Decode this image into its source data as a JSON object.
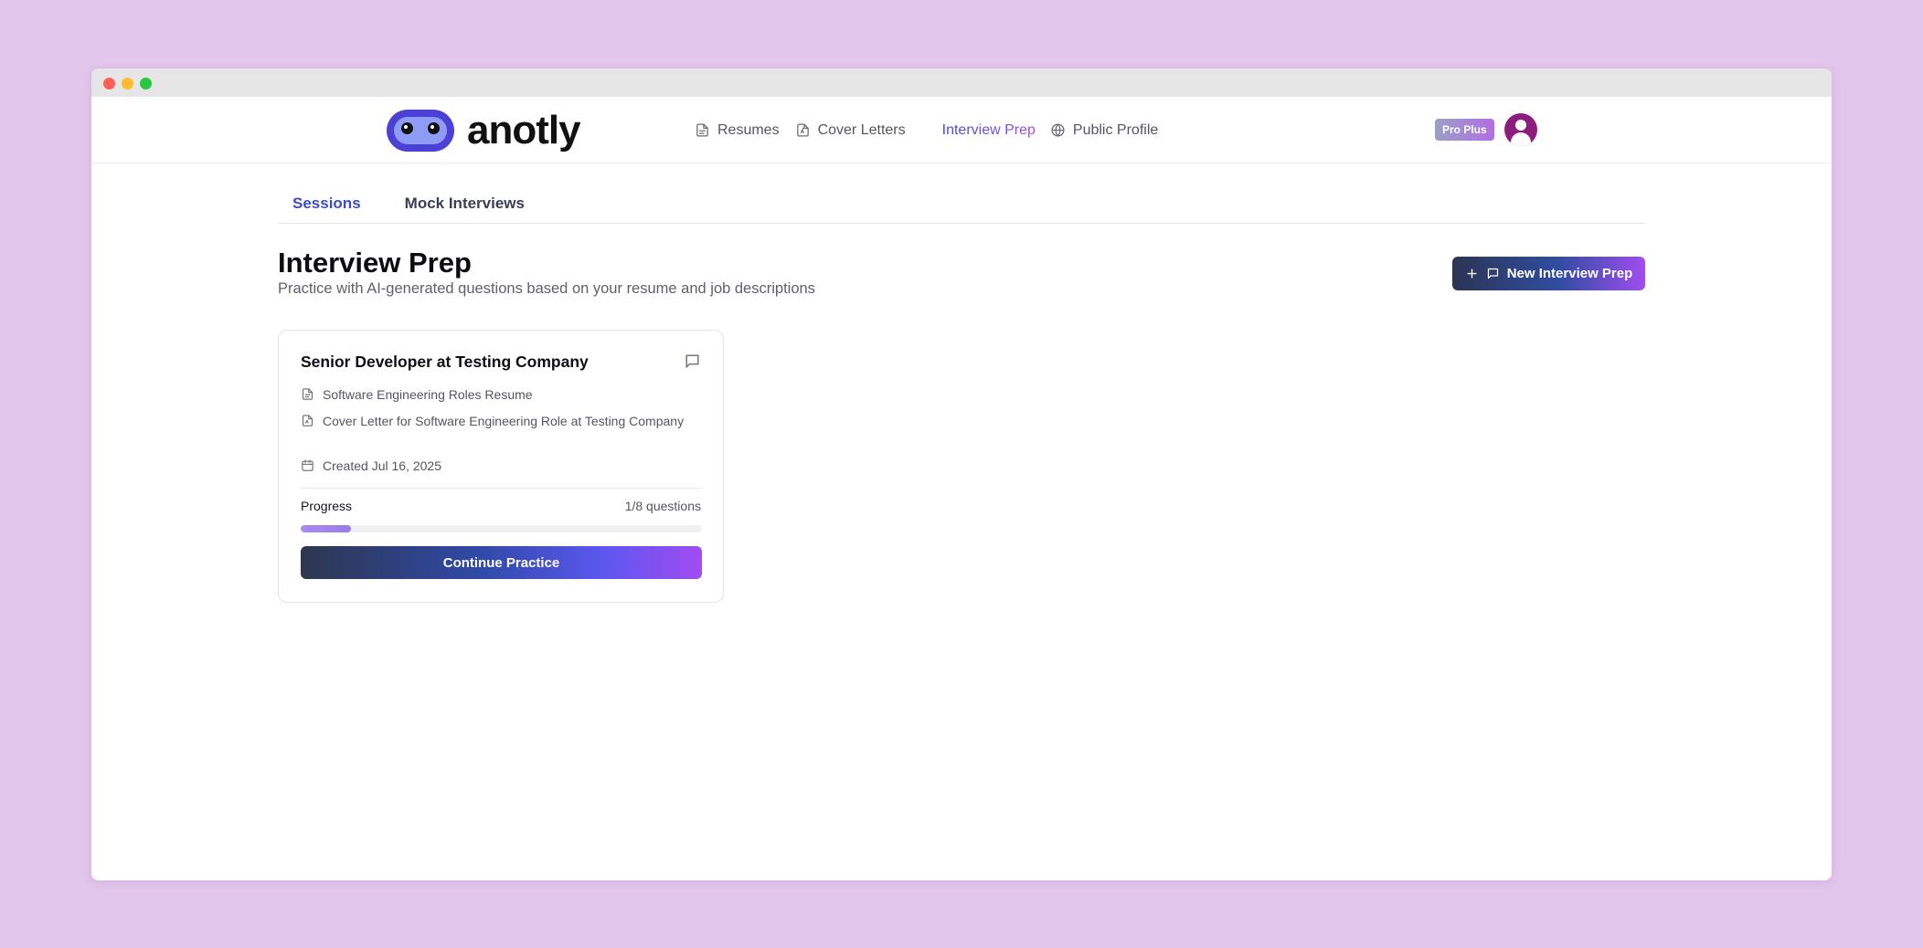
{
  "brand": {
    "name": "anotly"
  },
  "nav": {
    "items": [
      {
        "label": "Resumes",
        "icon": "file-text-icon"
      },
      {
        "label": "Cover Letters",
        "icon": "file-signature-icon"
      },
      {
        "label": "Interview Prep",
        "icon": "",
        "active": true
      },
      {
        "label": "Public Profile",
        "icon": "globe-icon"
      }
    ],
    "badge": "Pro Plus"
  },
  "tabs": [
    {
      "label": "Sessions",
      "active": true
    },
    {
      "label": "Mock Interviews",
      "active": false
    }
  ],
  "header": {
    "title": "Interview Prep",
    "subtitle": "Practice with AI-generated questions based on your resume and job descriptions",
    "new_button_label": "New Interview Prep"
  },
  "sessions": [
    {
      "title": "Senior Developer at Testing Company",
      "resume": "Software Engineering Roles Resume",
      "cover_letter": "Cover Letter for Software Engineering Role at Testing Company",
      "created": "Created Jul 16, 2025",
      "progress_label": "Progress",
      "progress_count": "1/8 questions",
      "progress_fraction": 0.125,
      "button_label": "Continue Practice"
    }
  ],
  "colors": {
    "page_background": "#e3c6ec",
    "accent_blue": "#3b4dc2",
    "accent_purple": "#a24cf2",
    "avatar": "#8c1d7d",
    "progress_fill": "#a78bf0"
  }
}
